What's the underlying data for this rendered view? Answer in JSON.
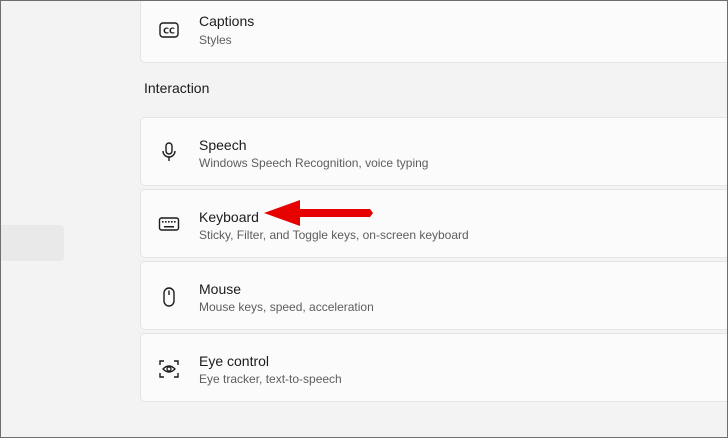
{
  "captions": {
    "title": "Captions",
    "subtitle": "Styles"
  },
  "section": {
    "header": "Interaction"
  },
  "items": [
    {
      "title": "Speech",
      "subtitle": "Windows Speech Recognition, voice typing"
    },
    {
      "title": "Keyboard",
      "subtitle": "Sticky, Filter, and Toggle keys, on-screen keyboard"
    },
    {
      "title": "Mouse",
      "subtitle": "Mouse keys, speed, acceleration"
    },
    {
      "title": "Eye control",
      "subtitle": "Eye tracker, text-to-speech"
    }
  ],
  "annotation": {
    "arrow_color": "#e60000"
  },
  "icons": [
    "captions-icon",
    "microphone-icon",
    "keyboard-icon",
    "mouse-icon",
    "eye-control-icon"
  ]
}
